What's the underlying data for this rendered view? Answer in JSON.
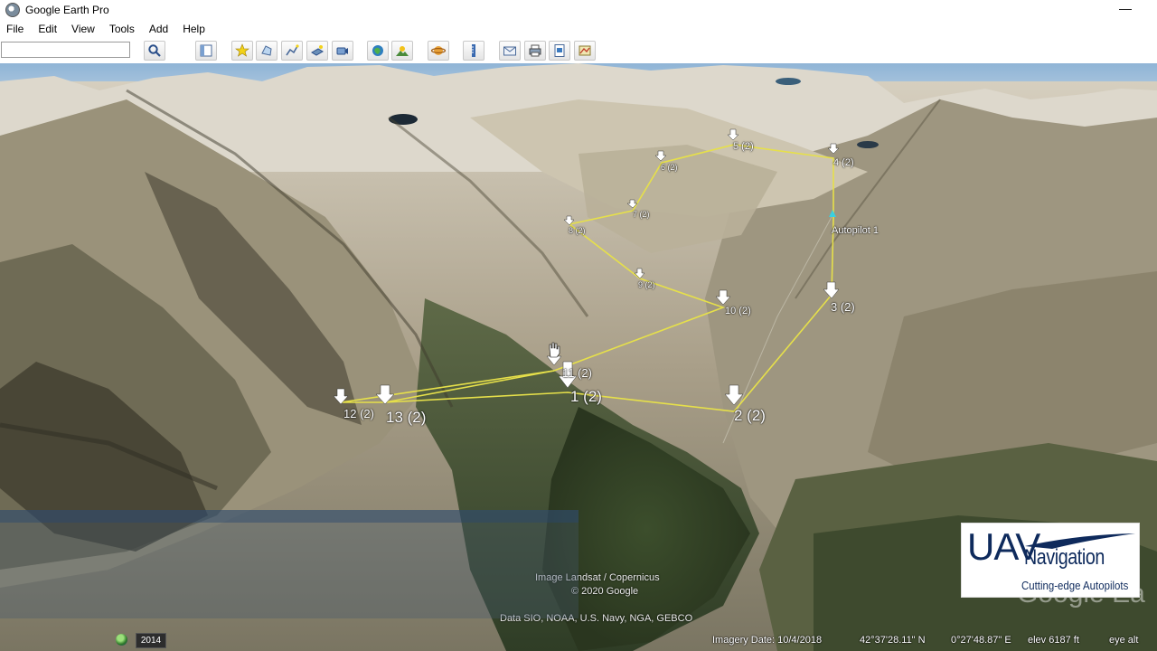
{
  "window": {
    "title": "Google Earth Pro"
  },
  "menu": [
    "File",
    "Edit",
    "View",
    "Tools",
    "Add",
    "Help"
  ],
  "search": {
    "value": "",
    "placeholder": ""
  },
  "toolbar_icons": [
    "sidebar-toggle-icon",
    "placemark-icon",
    "polygon-icon",
    "path-icon",
    "image-overlay-icon",
    "record-tour-icon",
    "historical-imagery-icon",
    "sunlight-icon",
    "planets-icon",
    "ruler-icon",
    "email-icon",
    "print-icon",
    "save-image-icon",
    "view-in-maps-icon"
  ],
  "waypoints": [
    {
      "id": "wp-1",
      "label": "1 (2)"
    },
    {
      "id": "wp-2",
      "label": "2 (2)"
    },
    {
      "id": "wp-3",
      "label": "3 (2)"
    },
    {
      "id": "wp-4",
      "label": "4 (2)"
    },
    {
      "id": "wp-5",
      "label": "5 (2)"
    },
    {
      "id": "wp-6",
      "label": "6 (2)"
    },
    {
      "id": "wp-7",
      "label": "7 (2)"
    },
    {
      "id": "wp-8",
      "label": "8 (2)"
    },
    {
      "id": "wp-9",
      "label": "9 (2)"
    },
    {
      "id": "wp-10",
      "label": "10 (2)"
    },
    {
      "id": "wp-11",
      "label": "11 (2)"
    },
    {
      "id": "wp-12",
      "label": "12 (2)"
    },
    {
      "id": "wp-13",
      "label": "13 (2)"
    }
  ],
  "autopilot": {
    "label": "Autopilot 1"
  },
  "path_color": "#e6e04a",
  "attribution": {
    "image": "Image Landsat / Copernicus",
    "copyright": "© 2020 Google",
    "data": "Data SIO, NOAA, U.S. Navy, NGA, GEBCO"
  },
  "status": {
    "year": "2014",
    "imagery_date": "Imagery Date: 10/4/2018",
    "lat": "42°37'28.11\" N",
    "lon": "0°27'48.87\" E",
    "elev": "elev  6187 ft",
    "eye_alt": "eye alt"
  },
  "logo": {
    "uav": "UAV",
    "navigation": "Navigation",
    "tagline": "Cutting-edge Autopilots",
    "brand_color": "#0e2a5c"
  },
  "watermark": "Google Ea"
}
